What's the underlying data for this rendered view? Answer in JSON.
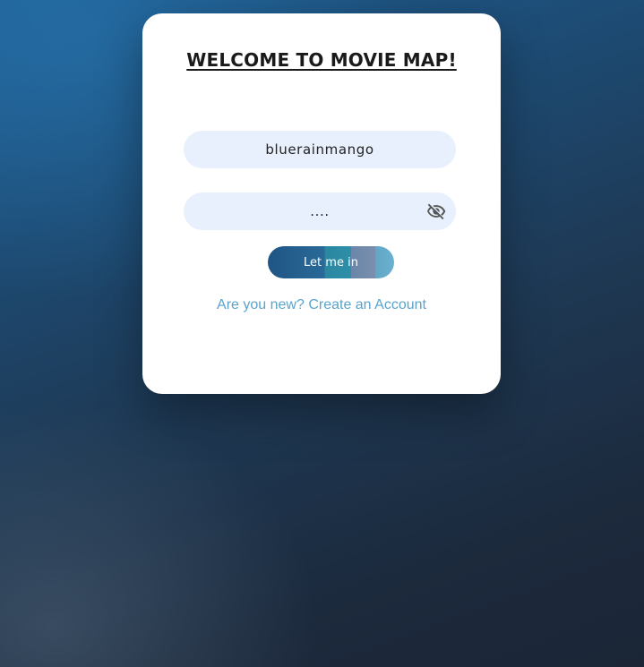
{
  "card": {
    "title": "WELCOME TO MOVIE MAP!"
  },
  "form": {
    "username_value": "bluerainmango",
    "password_value": "....",
    "password_toggle_icon": "eye-slash-icon",
    "submit_label": "Let me in",
    "signup_link": "Are you new? Create an Account"
  },
  "colors": {
    "field_bg": "#e8f0fd",
    "link": "#5ba3cb",
    "title": "#1a1a1a"
  }
}
